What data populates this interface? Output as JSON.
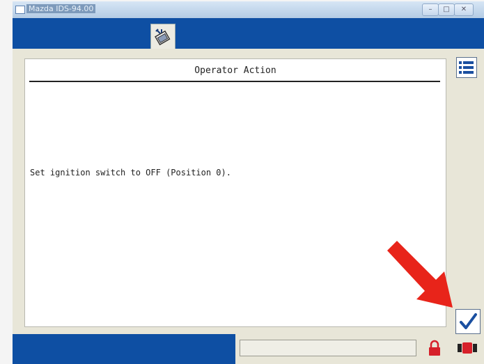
{
  "window": {
    "title": "Mazda IDS-94.00",
    "controls": [
      "minimize",
      "maximize",
      "close"
    ]
  },
  "panel": {
    "title": "Operator Action",
    "instruction": "Set ignition switch to OFF (Position 0)."
  },
  "icons": {
    "toolbar_tab": "wrench-book-icon",
    "side_list": "list-icon",
    "confirm": "checkmark-icon",
    "annotation": "red-arrow-icon",
    "status_lock": "lock-icon",
    "status_record": "record-icon"
  },
  "colors": {
    "app_blue": "#0e4fa3",
    "panel_bg": "#ffffff",
    "app_bg": "#e8e6d8",
    "annotation_red": "#e8241a",
    "lock_red": "#d6202a"
  }
}
